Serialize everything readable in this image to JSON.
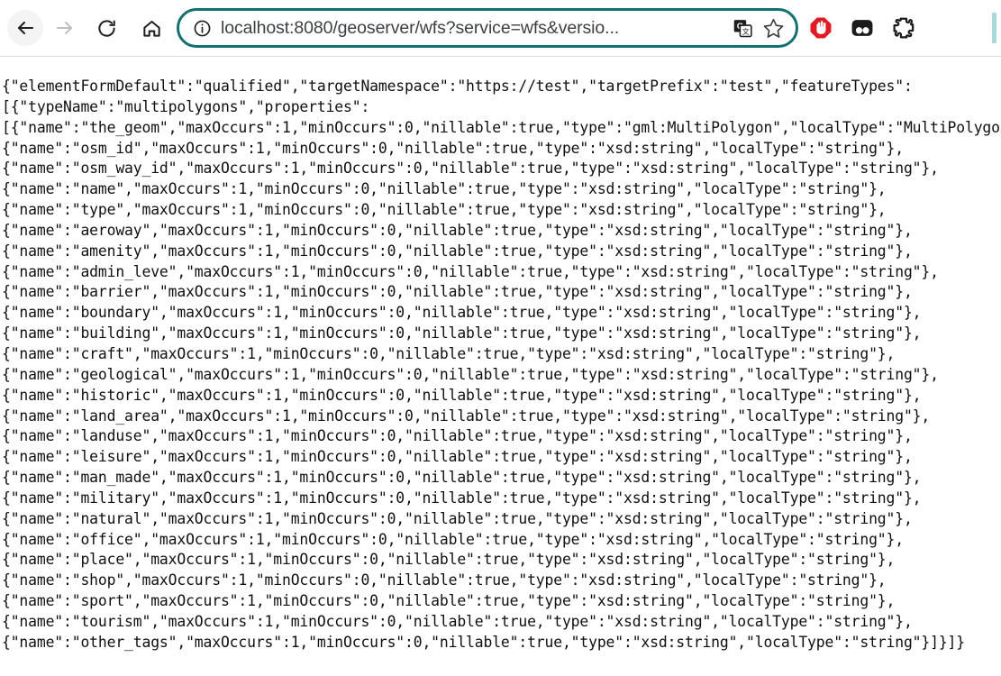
{
  "browser": {
    "nav": {
      "back_label": "Back",
      "back_icon": "arrow-left-icon",
      "forward_label": "Forward",
      "forward_icon": "arrow-right-icon",
      "reload_label": "Reload",
      "reload_icon": "reload-icon",
      "home_label": "Home",
      "home_icon": "home-icon"
    },
    "omnibox": {
      "site_info_icon": "info-circle-icon",
      "url": "localhost:8080/geoserver/wfs?service=wfs&versio...",
      "full_url_hint": "localhost:8080/geoserver/wfs?service=wfs&version=...",
      "translate_icon": "translate-icon",
      "bookmark_icon": "star-outline-icon",
      "focus_ring_color": "#137070"
    },
    "extensions": [
      {
        "name": "adblock-icon",
        "label": "AdBlock",
        "color": "#e01b24"
      },
      {
        "name": "dark-reader-icon",
        "label": "Extension",
        "color": "#1b1b1b"
      },
      {
        "name": "puzzle-piece-icon",
        "label": "Extensions",
        "color": "#1b1b1b"
      }
    ],
    "right_edge_accent_color": "#a8dadc"
  },
  "response": {
    "content_type": "application/json",
    "lines": [
      "{\"elementFormDefault\":\"qualified\",\"targetNamespace\":\"https://test\",\"targetPrefix\":\"test\",\"featureTypes\":",
      "[{\"typeName\":\"multipolygons\",\"properties\":",
      "[{\"name\":\"the_geom\",\"maxOccurs\":1,\"minOccurs\":0,\"nillable\":true,\"type\":\"gml:MultiPolygon\",\"localType\":\"MultiPolygon\"},",
      "{\"name\":\"osm_id\",\"maxOccurs\":1,\"minOccurs\":0,\"nillable\":true,\"type\":\"xsd:string\",\"localType\":\"string\"},",
      "{\"name\":\"osm_way_id\",\"maxOccurs\":1,\"minOccurs\":0,\"nillable\":true,\"type\":\"xsd:string\",\"localType\":\"string\"},",
      "{\"name\":\"name\",\"maxOccurs\":1,\"minOccurs\":0,\"nillable\":true,\"type\":\"xsd:string\",\"localType\":\"string\"},",
      "{\"name\":\"type\",\"maxOccurs\":1,\"minOccurs\":0,\"nillable\":true,\"type\":\"xsd:string\",\"localType\":\"string\"},",
      "{\"name\":\"aeroway\",\"maxOccurs\":1,\"minOccurs\":0,\"nillable\":true,\"type\":\"xsd:string\",\"localType\":\"string\"},",
      "{\"name\":\"amenity\",\"maxOccurs\":1,\"minOccurs\":0,\"nillable\":true,\"type\":\"xsd:string\",\"localType\":\"string\"},",
      "{\"name\":\"admin_leve\",\"maxOccurs\":1,\"minOccurs\":0,\"nillable\":true,\"type\":\"xsd:string\",\"localType\":\"string\"},",
      "{\"name\":\"barrier\",\"maxOccurs\":1,\"minOccurs\":0,\"nillable\":true,\"type\":\"xsd:string\",\"localType\":\"string\"},",
      "{\"name\":\"boundary\",\"maxOccurs\":1,\"minOccurs\":0,\"nillable\":true,\"type\":\"xsd:string\",\"localType\":\"string\"},",
      "{\"name\":\"building\",\"maxOccurs\":1,\"minOccurs\":0,\"nillable\":true,\"type\":\"xsd:string\",\"localType\":\"string\"},",
      "{\"name\":\"craft\",\"maxOccurs\":1,\"minOccurs\":0,\"nillable\":true,\"type\":\"xsd:string\",\"localType\":\"string\"},",
      "{\"name\":\"geological\",\"maxOccurs\":1,\"minOccurs\":0,\"nillable\":true,\"type\":\"xsd:string\",\"localType\":\"string\"},",
      "{\"name\":\"historic\",\"maxOccurs\":1,\"minOccurs\":0,\"nillable\":true,\"type\":\"xsd:string\",\"localType\":\"string\"},",
      "{\"name\":\"land_area\",\"maxOccurs\":1,\"minOccurs\":0,\"nillable\":true,\"type\":\"xsd:string\",\"localType\":\"string\"},",
      "{\"name\":\"landuse\",\"maxOccurs\":1,\"minOccurs\":0,\"nillable\":true,\"type\":\"xsd:string\",\"localType\":\"string\"},",
      "{\"name\":\"leisure\",\"maxOccurs\":1,\"minOccurs\":0,\"nillable\":true,\"type\":\"xsd:string\",\"localType\":\"string\"},",
      "{\"name\":\"man_made\",\"maxOccurs\":1,\"minOccurs\":0,\"nillable\":true,\"type\":\"xsd:string\",\"localType\":\"string\"},",
      "{\"name\":\"military\",\"maxOccurs\":1,\"minOccurs\":0,\"nillable\":true,\"type\":\"xsd:string\",\"localType\":\"string\"},",
      "{\"name\":\"natural\",\"maxOccurs\":1,\"minOccurs\":0,\"nillable\":true,\"type\":\"xsd:string\",\"localType\":\"string\"},",
      "{\"name\":\"office\",\"maxOccurs\":1,\"minOccurs\":0,\"nillable\":true,\"type\":\"xsd:string\",\"localType\":\"string\"},",
      "{\"name\":\"place\",\"maxOccurs\":1,\"minOccurs\":0,\"nillable\":true,\"type\":\"xsd:string\",\"localType\":\"string\"},",
      "{\"name\":\"shop\",\"maxOccurs\":1,\"minOccurs\":0,\"nillable\":true,\"type\":\"xsd:string\",\"localType\":\"string\"},",
      "{\"name\":\"sport\",\"maxOccurs\":1,\"minOccurs\":0,\"nillable\":true,\"type\":\"xsd:string\",\"localType\":\"string\"},",
      "{\"name\":\"tourism\",\"maxOccurs\":1,\"minOccurs\":0,\"nillable\":true,\"type\":\"xsd:string\",\"localType\":\"string\"},",
      "{\"name\":\"other_tags\",\"maxOccurs\":1,\"minOccurs\":0,\"nillable\":true,\"type\":\"xsd:string\",\"localType\":\"string\"}]}]}"
    ]
  }
}
